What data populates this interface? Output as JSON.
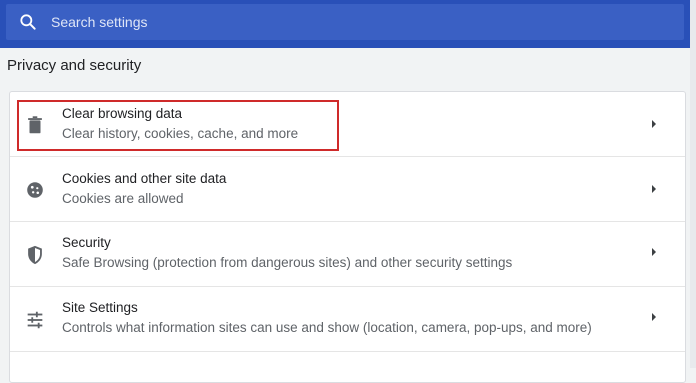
{
  "search": {
    "placeholder": "Search settings",
    "icon": "search-icon"
  },
  "section": {
    "title": "Privacy and security"
  },
  "items": [
    {
      "title": "Clear browsing data",
      "description": "Clear history, cookies, cache, and more",
      "icon": "trash-icon",
      "highlighted": true
    },
    {
      "title": "Cookies and other site data",
      "description": "Cookies are allowed",
      "icon": "cookie-icon"
    },
    {
      "title": "Security",
      "description": "Safe Browsing (protection from dangerous sites) and other security settings",
      "icon": "shield-icon"
    },
    {
      "title": "Site Settings",
      "description": "Controls what information sites can use and show (location, camera, pop-ups, and more)",
      "icon": "tune-sliders-icon"
    }
  ],
  "colors": {
    "header": "#2950b8",
    "highlight_border": "#cf2a2a"
  }
}
